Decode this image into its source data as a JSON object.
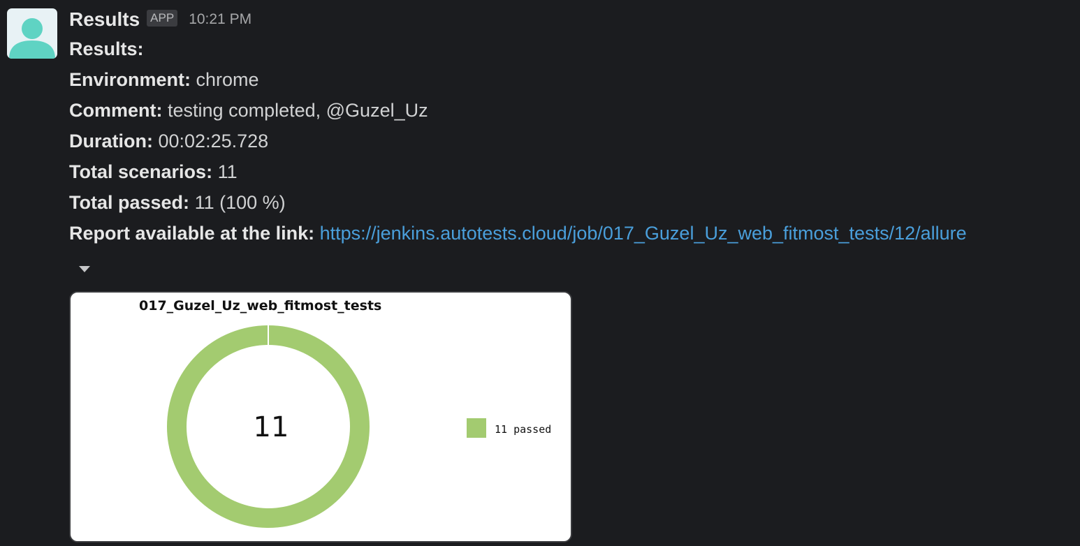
{
  "sender": {
    "name": "Results",
    "badge": "APP",
    "time": "10:21 PM"
  },
  "body": {
    "heading": "Results:",
    "environment": {
      "label": "Environment:",
      "value": "chrome"
    },
    "comment": {
      "label": "Comment:",
      "value": "testing completed, @Guzel_Uz"
    },
    "duration": {
      "label": "Duration:",
      "value": "00:02:25.728"
    },
    "total_scenarios": {
      "label": "Total scenarios:",
      "value": "11"
    },
    "total_passed": {
      "label": "Total passed:",
      "value": "11 (100 %)"
    },
    "report": {
      "label": "Report available at the link:",
      "url": "https://jenkins.autotests.cloud/job/017_Guzel_Uz_web_fitmost_tests/12/allure"
    }
  },
  "colors": {
    "background": "#1b1c1f",
    "link": "#4a9fdb",
    "avatar": "#5fd3c3",
    "passed": "#a3cb70"
  },
  "icons": {
    "avatar": "person-icon",
    "collapse": "caret-down-icon"
  },
  "chart_data": {
    "type": "pie",
    "title": "017_Guzel_Uz_web_fitmost_tests",
    "center_label": "11",
    "slices": [
      {
        "label": "passed",
        "value": 11,
        "color": "#a3cb70"
      }
    ],
    "legend": [
      "11 passed"
    ],
    "legend_position": "right"
  }
}
